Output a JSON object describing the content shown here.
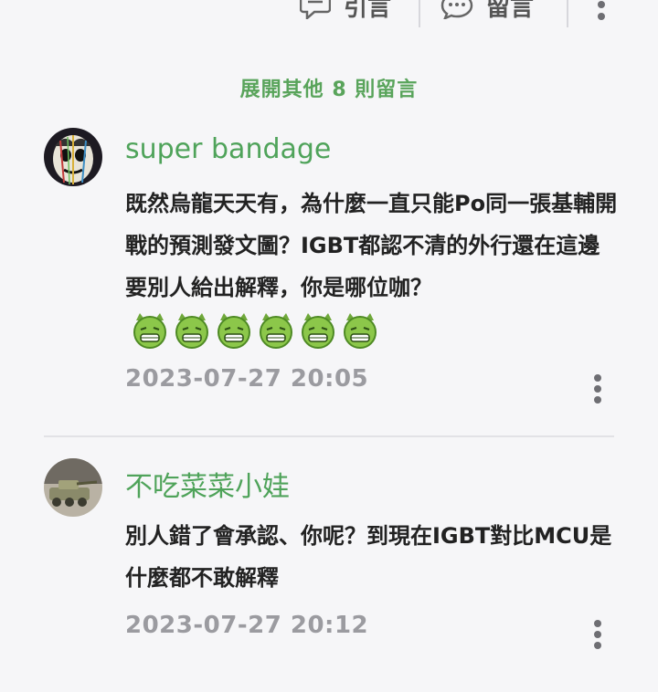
{
  "top_actions": {
    "quote_label": "引言",
    "reply_label": "留言"
  },
  "expand_label": "展開其他 8 則留言",
  "comments": [
    {
      "username": "super bandage",
      "text": "既然烏龍天天有，為什麼一直只能Po同一張基輔開戰的預測發文圖？IGBT都認不清的外行還在這邊要別人給出解釋，你是哪位咖？",
      "emojis": [
        "grin-devil-icon",
        "grin-devil-icon",
        "grin-devil-icon",
        "grin-devil-icon",
        "grin-devil-icon",
        "grin-devil-icon"
      ],
      "timestamp": "2023-07-27 20:05"
    },
    {
      "username": "不吃菜菜小娃",
      "text": "別人錯了會承認、你呢？到現在IGBT對比MCU是什麼都不敢解釋",
      "timestamp": "2023-07-27 20:12"
    }
  ],
  "colors": {
    "accent_green": "#59a45b",
    "username_green": "#4fa35a",
    "text": "#222222",
    "timestamp": "#9b9ba0",
    "background": "#f6f6f8"
  }
}
